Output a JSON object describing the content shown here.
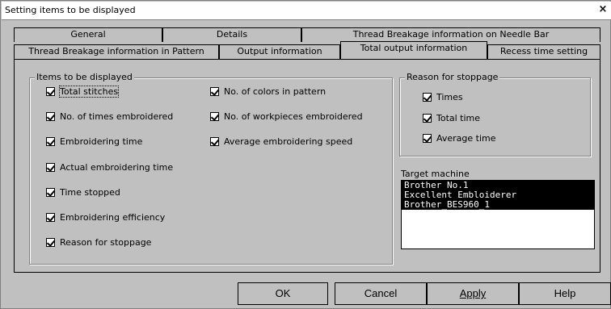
{
  "window": {
    "title": "Setting items to be displayed",
    "close_glyph": "×"
  },
  "tabs": {
    "row1": [
      "General",
      "Details",
      "Thread Breakage information on Needle Bar"
    ],
    "row2": [
      "Thread Breakage information in Pattern",
      "Output information",
      "Total output information",
      "Recess time setting"
    ],
    "active": "Total output information"
  },
  "items_group": {
    "legend": "Items to be displayed",
    "col1": [
      "Total stitches",
      "No. of times embroidered",
      "Embroidering time",
      "Actual embroidering time",
      "Time stopped",
      "Embroidering efficiency",
      "Reason for stoppage"
    ],
    "col2": [
      "No. of colors in pattern",
      "No. of workpieces embroidered",
      "Average embroidering speed"
    ]
  },
  "reason_group": {
    "legend": "Reason for stoppage",
    "items": [
      "Times",
      "Total time",
      "Average time"
    ]
  },
  "target": {
    "label": "Target machine",
    "machines": [
      "Brother No.1",
      "Excellent Embloiderer",
      "Brother_BES960_1"
    ]
  },
  "buttons": {
    "ok": "OK",
    "cancel": "Cancel",
    "apply": "Apply",
    "help": "Help"
  }
}
